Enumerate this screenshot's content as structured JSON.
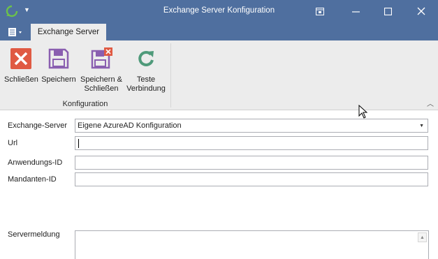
{
  "window": {
    "title": "Exchange Server Konfiguration"
  },
  "ribbon": {
    "tab_label": "Exchange Server",
    "group_label": "Konfiguration",
    "buttons": [
      {
        "line1": "Schließen",
        "line2": ""
      },
      {
        "line1": "Speichern",
        "line2": ""
      },
      {
        "line1": "Speichern &",
        "line2": "Schließen"
      },
      {
        "line1": "Teste",
        "line2": "Verbindung"
      }
    ]
  },
  "form": {
    "exchange_server_label": "Exchange-Server",
    "exchange_server_value": "Eigene AzureAD Konfiguration",
    "url_label": "Url",
    "url_value": "",
    "app_id_label": "Anwendungs-ID",
    "app_id_value": "",
    "tenant_id_label": "Mandanten-ID",
    "tenant_id_value": "",
    "server_message_label": "Servermeldung",
    "server_message_value": ""
  },
  "colors": {
    "titlebar": "#4f6f9f",
    "ribbon_bg": "#ececec",
    "close_icon": "#e05a43",
    "save_icon": "#8a5fb0",
    "test_icon": "#4f9a7a"
  }
}
